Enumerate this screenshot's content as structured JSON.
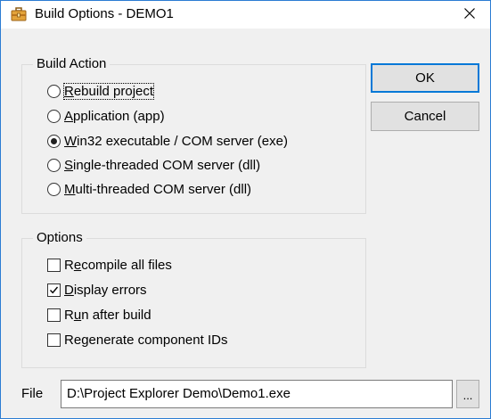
{
  "window": {
    "title": "Build Options - DEMO1",
    "title_icon": "toolbox-icon",
    "close_icon": "close-icon"
  },
  "build_action": {
    "legend": "Build Action",
    "options": [
      {
        "pre": "",
        "u": "R",
        "post": "ebuild project",
        "checked": false,
        "focused": true
      },
      {
        "pre": "",
        "u": "A",
        "post": "pplication (app)",
        "checked": false,
        "focused": false
      },
      {
        "pre": "",
        "u": "W",
        "post": "in32 executable / COM server (exe)",
        "checked": true,
        "focused": false
      },
      {
        "pre": "",
        "u": "S",
        "post": "ingle-threaded COM server (dll)",
        "checked": false,
        "focused": false
      },
      {
        "pre": "",
        "u": "M",
        "post": "ulti-threaded COM server (dll)",
        "checked": false,
        "focused": false
      }
    ]
  },
  "options": {
    "legend": "Options",
    "items": [
      {
        "pre": "R",
        "u": "e",
        "post": "compile all files",
        "checked": false
      },
      {
        "pre": "",
        "u": "D",
        "post": "isplay errors",
        "checked": true
      },
      {
        "pre": "R",
        "u": "u",
        "post": "n after build",
        "checked": false
      },
      {
        "pre": "Re",
        "u": "g",
        "post": "enerate component IDs",
        "checked": false
      }
    ]
  },
  "buttons": {
    "ok": "OK",
    "cancel": "Cancel"
  },
  "file": {
    "label": "File",
    "value": "D:\\Project Explorer Demo\\Demo1.exe",
    "browse": "..."
  }
}
